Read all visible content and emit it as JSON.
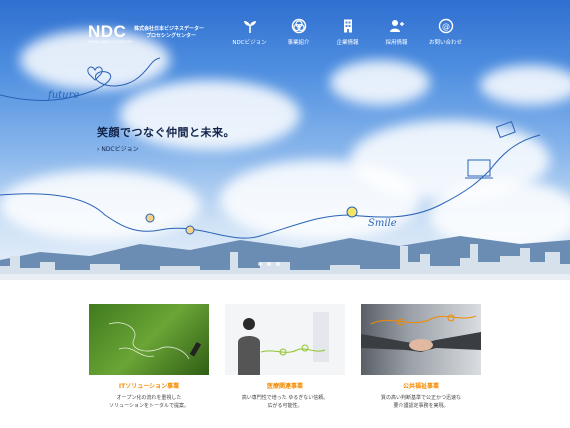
{
  "header": {
    "logo_mark": "NDC",
    "logo_sub": "NIHON DATA CONVERTER",
    "company_line1": "株式会社日本ビジネスデーター",
    "company_line2": "プロセシングセンター"
  },
  "nav": [
    {
      "label": "NDCビジョン",
      "icon": "sprout-icon"
    },
    {
      "label": "事業紹介",
      "icon": "circles-icon"
    },
    {
      "label": "企業情報",
      "icon": "building-icon"
    },
    {
      "label": "採用情報",
      "icon": "person-add-icon"
    },
    {
      "label": "お問い合わせ",
      "icon": "at-sign-icon"
    }
  ],
  "hero": {
    "tagline": "笑顔でつなぐ仲間と未来。",
    "vision_link": "NDCビジョン",
    "art_word1": "future",
    "art_word2": "Smile"
  },
  "cards": [
    {
      "title": "ITソリューション事業",
      "text1": "オープン化の流れを重視した",
      "text2": "ソリューションをトータルで提案。"
    },
    {
      "title": "医療関連事業",
      "text1": "高い専門性で培った ゆるぎない信頼。",
      "text2": "広がる可能性。"
    },
    {
      "title": "公共福祉事業",
      "text1": "質の高い判断基準で公正かつ迅速な",
      "text2": "要介護認定事務を実現。"
    }
  ],
  "colors": {
    "accent": "#f28a00",
    "sky_top": "#2f6fd0",
    "text_dark": "#12244a"
  }
}
